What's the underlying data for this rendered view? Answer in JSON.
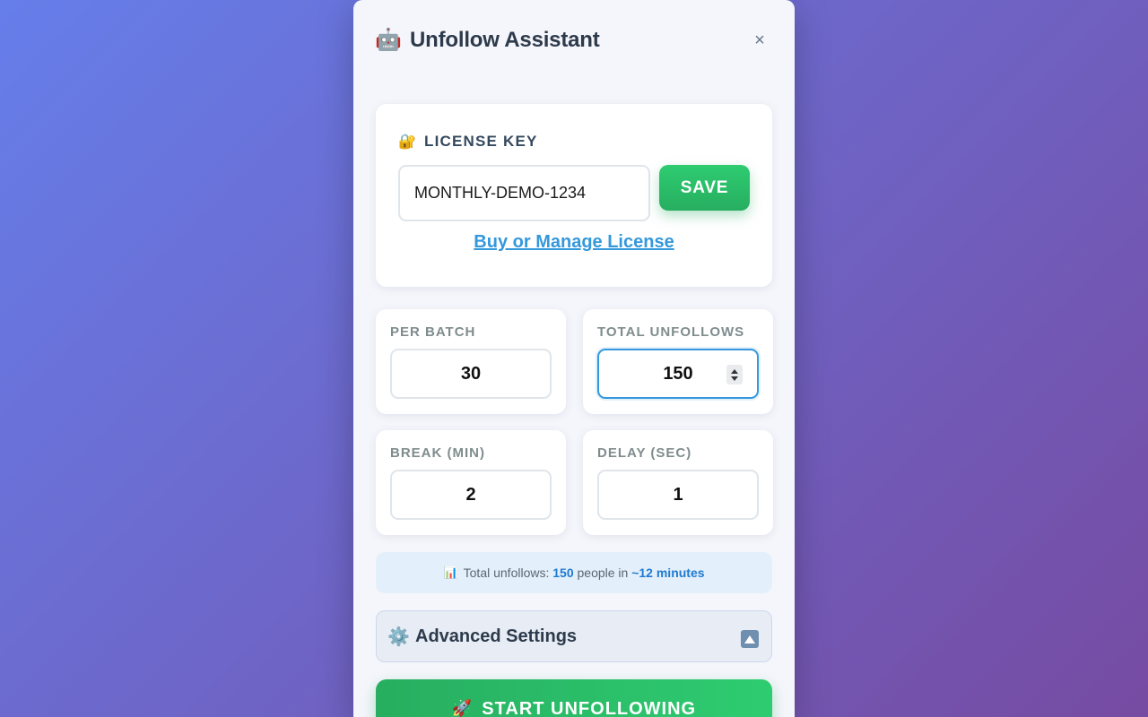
{
  "header": {
    "icon": "robot-icon",
    "icon_glyph": "🤖",
    "title": "Unfollow Assistant",
    "close_glyph": "×"
  },
  "license": {
    "icon": "lock-icon",
    "icon_glyph": "🔐",
    "label": "LICENSE KEY",
    "value": "MONTHLY-DEMO-1234",
    "save_label": "SAVE",
    "link_text": "Buy or Manage License"
  },
  "settings": {
    "per_batch": {
      "label": "PER BATCH",
      "value": "30"
    },
    "total_unfollows": {
      "label": "TOTAL UNFOLLOWS",
      "value": "150"
    },
    "break_min": {
      "label": "BREAK (MIN)",
      "value": "2"
    },
    "delay_sec": {
      "label": "DELAY (SEC)",
      "value": "1"
    }
  },
  "summary": {
    "icon": "bar-chart-icon",
    "icon_glyph": "📊",
    "prefix": "Total unfollows: ",
    "count": "150",
    "middle": " people in ",
    "duration": "~12 minutes"
  },
  "advanced": {
    "icon": "gear-icon",
    "icon_glyph": "⚙️",
    "title": "Advanced Settings",
    "toggle_icon": "chevron-up-icon"
  },
  "start": {
    "icon": "rocket-icon",
    "icon_glyph": "🚀",
    "label": "START UNFOLLOWING"
  },
  "colors": {
    "accent_green": "#27ae60",
    "link_blue": "#3498db",
    "background_gradient_start": "#667eea",
    "background_gradient_end": "#764ba2"
  }
}
